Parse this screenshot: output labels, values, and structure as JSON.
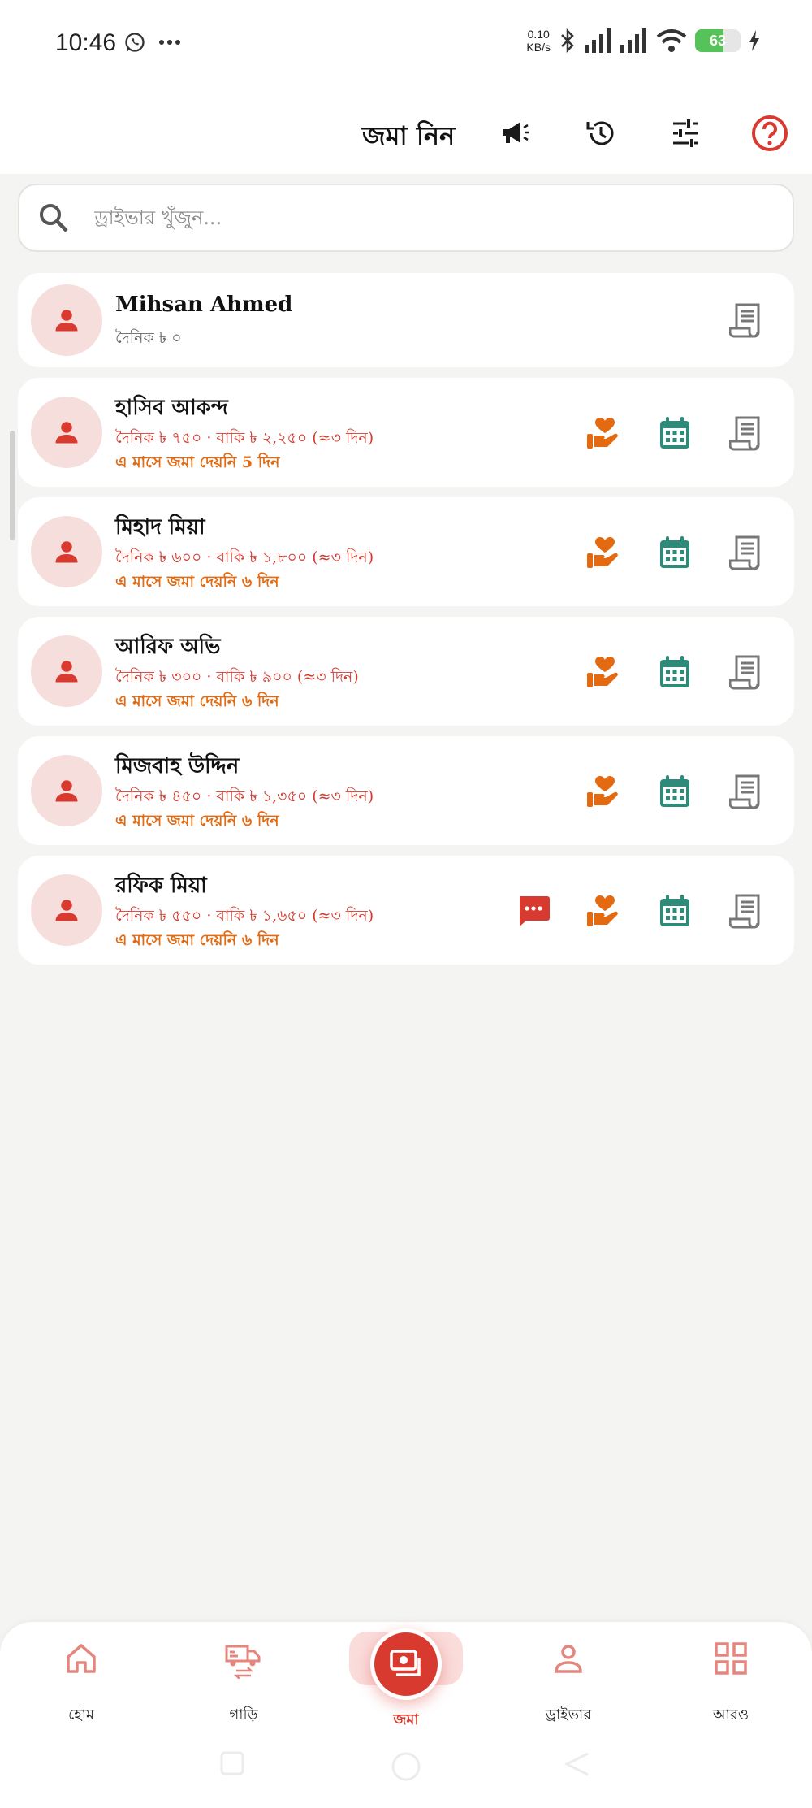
{
  "status_bar": {
    "time": "10:46",
    "net_speed_value": "0.10",
    "net_speed_unit": "KB/s",
    "battery_level": "63",
    "battery_fraction": 0.63
  },
  "app_bar": {
    "title": "জমা নিন"
  },
  "search": {
    "placeholder": "ড্রাইভার খুঁজুন..."
  },
  "drivers": [
    {
      "name": "Mihsan Ahmed",
      "info": "দৈনিক ৳ ০",
      "warning": "",
      "actions": [
        "receipt"
      ]
    },
    {
      "name": "হাসিব আকন্দ",
      "info": "দৈনিক ৳ ৭৫০ · বাকি ৳ ২,২৫০ (≈৩ দিন)",
      "warning": "এ মাসে জমা দেয়নি 5 দিন",
      "actions": [
        "donate",
        "calendar",
        "receipt"
      ]
    },
    {
      "name": "মিহাদ মিয়া",
      "info": "দৈনিক ৳ ৬০০ · বাকি ৳ ১,৮০০ (≈৩ দিন)",
      "warning": "এ মাসে জমা দেয়নি ৬ দিন",
      "actions": [
        "donate",
        "calendar",
        "receipt"
      ]
    },
    {
      "name": "আরিফ অভি",
      "info": "দৈনিক ৳ ৩০০ · বাকি ৳ ৯০০ (≈৩ দিন)",
      "warning": "এ মাসে জমা দেয়নি ৬ দিন",
      "actions": [
        "donate",
        "calendar",
        "receipt"
      ]
    },
    {
      "name": "মিজবাহ উদ্দিন",
      "info": "দৈনিক ৳ ৪৫০ · বাকি ৳ ১,৩৫০ (≈৩ দিন)",
      "warning": "এ মাসে জমা দেয়নি ৬ দিন",
      "actions": [
        "donate",
        "calendar",
        "receipt"
      ]
    },
    {
      "name": "রফিক মিয়া",
      "info": "দৈনিক ৳ ৫৫০ · বাকি ৳ ১,৬৫০ (≈৩ দিন)",
      "warning": "এ মাসে জমা দেয়নি ৬ দিন",
      "actions": [
        "sms",
        "donate",
        "calendar",
        "receipt"
      ]
    }
  ],
  "bottom_nav": {
    "home": "হোম",
    "vehicles": "গাড়ি",
    "deposit": "জমা",
    "drivers": "ড্রাইভার",
    "more": "আরও"
  },
  "colors": {
    "accent_red": "#d93a30",
    "warning_orange": "#e36a10",
    "calendar_teal": "#2e8b7a",
    "receipt_gray": "#777777"
  }
}
